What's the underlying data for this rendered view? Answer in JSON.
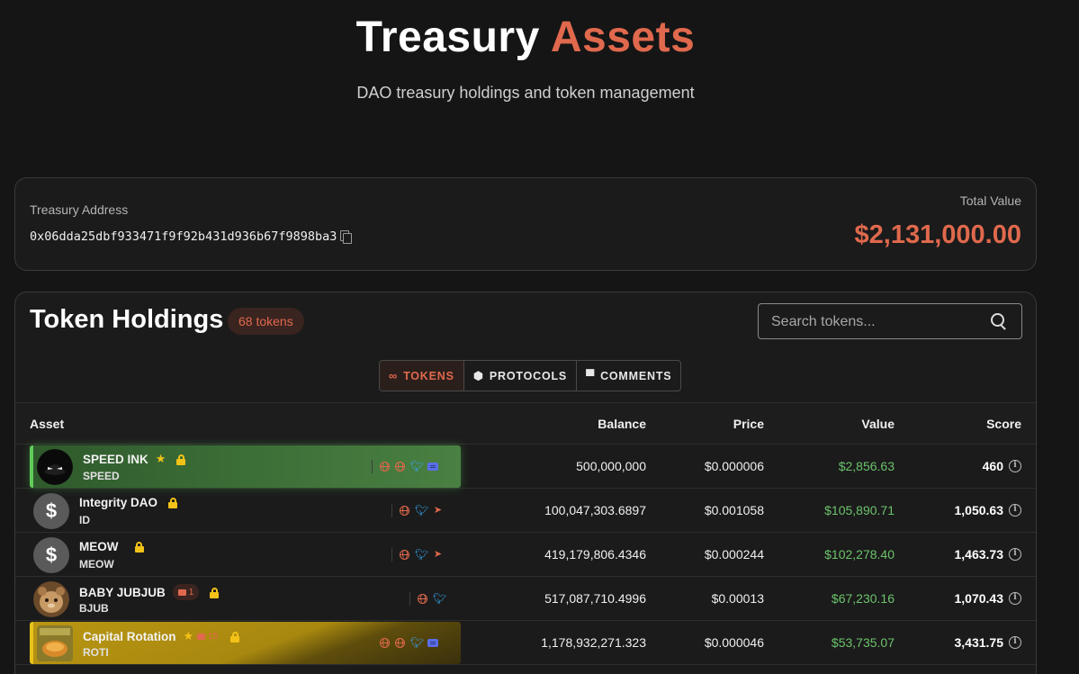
{
  "header": {
    "title_main": "Treasury",
    "title_accent": "Assets",
    "subtitle": "DAO treasury holdings and token management"
  },
  "treasury": {
    "address_label": "Treasury Address",
    "address": "0x06dda25dbf933471f9f92b431d936b67f9898ba3",
    "total_label": "Total Value",
    "total_value": "$2,131,000.00",
    "accent_color": "#e0694d"
  },
  "holdings": {
    "title": "Token Holdings",
    "count": "68 tokens",
    "search_placeholder": "Search tokens...",
    "tabs": [
      {
        "label": "TOKENS",
        "icon": "infinity-icon",
        "active": true
      },
      {
        "label": "PROTOCOLS",
        "icon": "cube-icon",
        "active": false
      },
      {
        "label": "COMMENTS",
        "icon": "comment-icon",
        "active": false
      }
    ],
    "columns": [
      "Asset",
      "Balance",
      "Price",
      "Value",
      "Score"
    ],
    "rows": [
      {
        "name": "SPEED INK",
        "symbol": "SPEED",
        "starred": true,
        "locked": true,
        "comments": "",
        "balance": "500,000,000",
        "price": "$0.000006",
        "value": "$2,856.63",
        "score": "460",
        "highlight": "green",
        "avatar": "speed-ink-avatar",
        "links": [
          "globe-icon",
          "globe-icon",
          "twitter-icon",
          "discord-icon"
        ]
      },
      {
        "name": "Integrity DAO",
        "symbol": "ID",
        "starred": false,
        "locked": true,
        "comments": "",
        "balance": "100,047,303.6897",
        "price": "$0.001058",
        "value": "$105,890.71",
        "score": "1,050.63",
        "highlight": "",
        "avatar": "dollar-avatar",
        "links": [
          "globe-icon",
          "twitter-icon",
          "telegram-icon"
        ]
      },
      {
        "name": "MEOW",
        "symbol": "MEOW",
        "starred": false,
        "locked": true,
        "comments": "",
        "balance": "419,179,806.4346",
        "price": "$0.000244",
        "value": "$102,278.40",
        "score": "1,463.73",
        "highlight": "",
        "avatar": "dollar-avatar",
        "links": [
          "globe-icon",
          "twitter-icon",
          "telegram-icon"
        ]
      },
      {
        "name": "BABY JUBJUB",
        "symbol": "BJUB",
        "starred": false,
        "locked": true,
        "comments": "1",
        "balance": "517,087,710.4996",
        "price": "$0.00013",
        "value": "$67,230.16",
        "score": "1,070.43",
        "highlight": "",
        "avatar": "bjub-avatar",
        "links": [
          "globe-icon",
          "twitter-icon"
        ]
      },
      {
        "name": "Capital Rotation",
        "symbol": "ROTI",
        "starred": true,
        "locked": true,
        "comments": "15",
        "balance": "1,178,932,271.323",
        "price": "$0.000046",
        "value": "$53,735.07",
        "score": "3,431.75",
        "highlight": "gold",
        "avatar": "roti-avatar",
        "links": [
          "globe-icon",
          "globe-icon",
          "twitter-icon",
          "discord-icon"
        ]
      }
    ]
  }
}
